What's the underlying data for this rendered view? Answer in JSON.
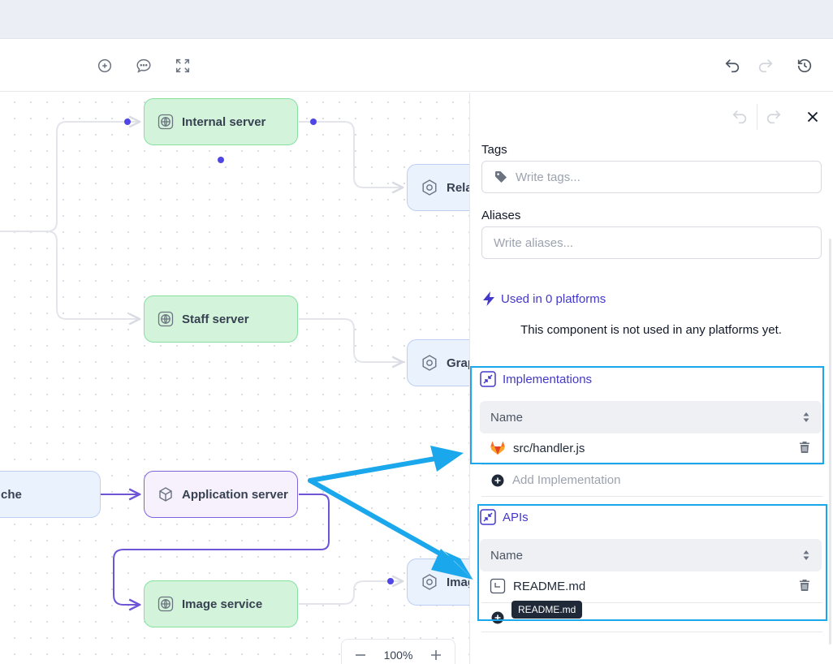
{
  "canvas": {
    "nodes": {
      "internal_server": "Internal server",
      "staff_server": "Staff server",
      "application_server": "Application server",
      "image_service": "Image service",
      "relat": "Relat",
      "grap": "Grap",
      "imag": "Imag",
      "che": "che"
    },
    "zoom_level": "100%"
  },
  "panel": {
    "tags_label": "Tags",
    "tags_placeholder": "Write tags...",
    "aliases_label": "Aliases",
    "aliases_placeholder": "Write aliases...",
    "used_in": "Used in 0 platforms",
    "used_empty": "This component is not used in any platforms yet.",
    "implementations": {
      "title": "Implementations",
      "column": "Name",
      "rows": [
        "src/handler.js"
      ],
      "add_label": "Add Implementation"
    },
    "apis": {
      "title": "APIs",
      "column": "Name",
      "rows": [
        "README.md"
      ],
      "tooltip": "README.md"
    }
  },
  "colors": {
    "accent": "#4338ca",
    "highlight": "#1aa7ec",
    "node_green": "#d3f4da",
    "node_blue": "#eaf2fd",
    "node_purple_border": "#7d64dc",
    "connector_dot": "#4f46e5"
  },
  "icons": {
    "toolbar": [
      "add-circle-icon",
      "comment-icon",
      "fullscreen-icon",
      "undo-icon",
      "redo-icon",
      "history-icon"
    ],
    "panel": [
      "undo-icon",
      "redo-icon",
      "close-icon",
      "tag-icon",
      "bolt-icon",
      "collapse-icon",
      "gitlab-icon",
      "document-icon",
      "trash-icon",
      "plus-circle-icon"
    ]
  }
}
